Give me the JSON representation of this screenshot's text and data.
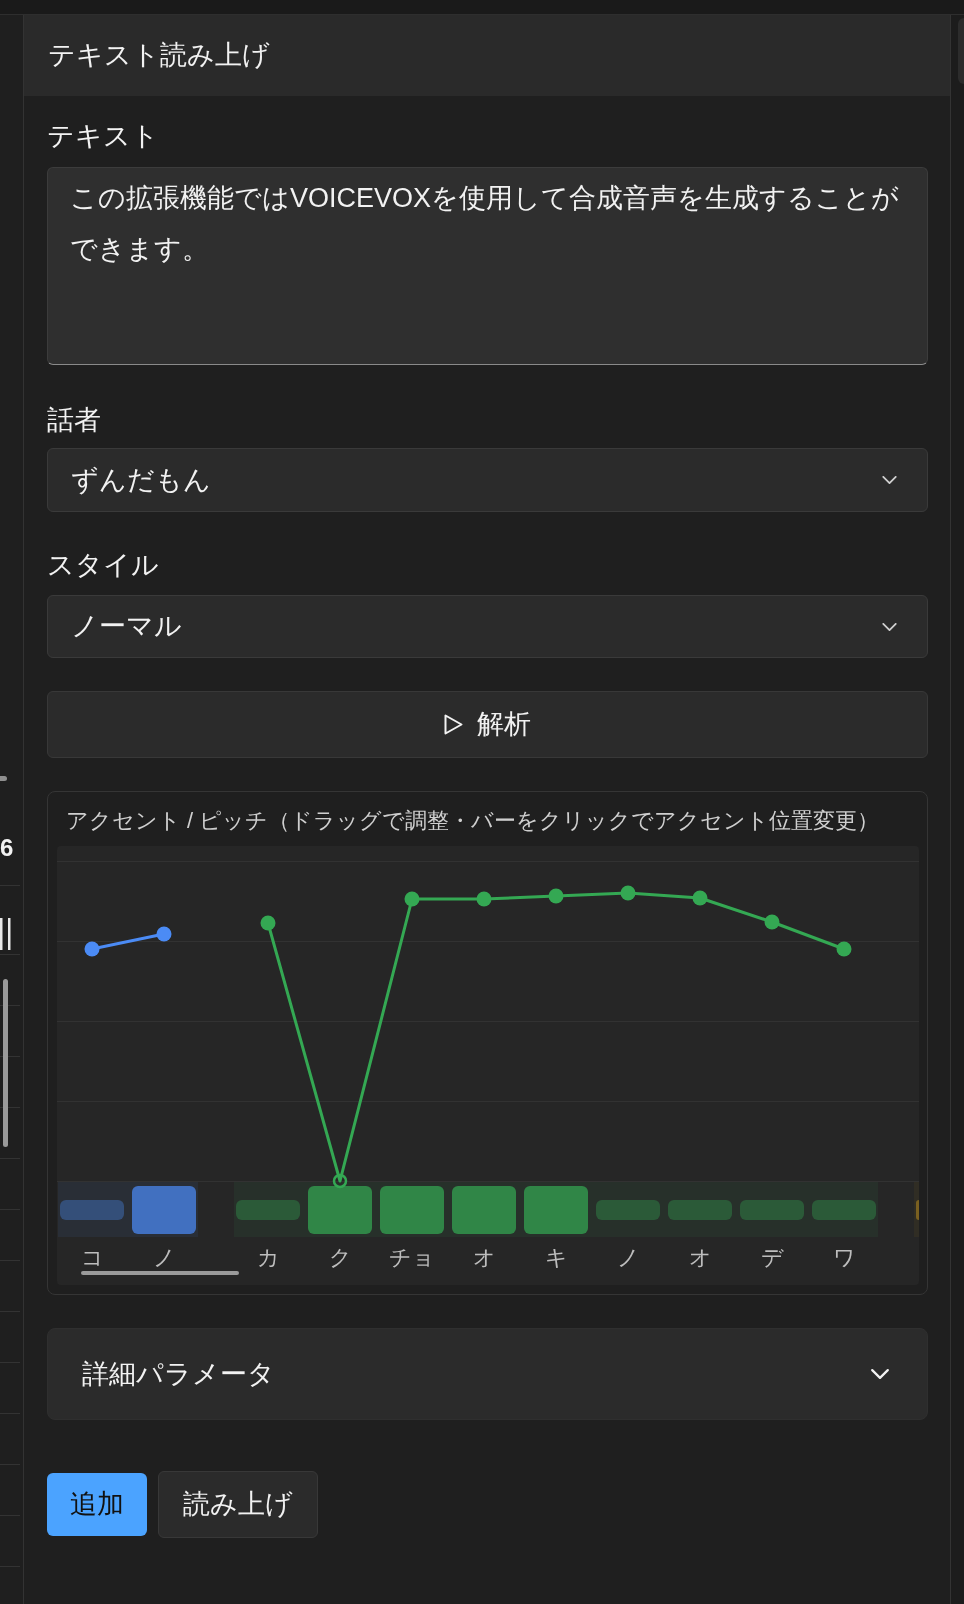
{
  "side_panel": {
    "value": "6"
  },
  "panel": {
    "title": "テキスト読み上げ"
  },
  "text": {
    "label": "テキスト",
    "value": "この拡張機能ではVOICEVOXを使用して合成音声を生成することができます。"
  },
  "speaker": {
    "label": "話者",
    "value": "ずんだもん"
  },
  "style": {
    "label": "スタイル",
    "value": "ノーマル"
  },
  "analyze_button": {
    "label": "解析"
  },
  "accent_editor": {
    "title": "アクセント / ピッチ（ドラッグで調整・バーをクリックでアクセント位置変更）",
    "phrases": [
      {
        "color": "#4b8bf5",
        "moras": [
          {
            "label": "コ",
            "high": false,
            "voiced": true
          },
          {
            "label": "ノ",
            "high": true,
            "voiced": true
          }
        ]
      },
      {
        "color": "#34a853",
        "moras": [
          {
            "label": "カ",
            "high": false,
            "voiced": true
          },
          {
            "label": "ク",
            "high": true,
            "voiced": false
          },
          {
            "label": "チョ",
            "high": true,
            "voiced": true
          },
          {
            "label": "オ",
            "high": true,
            "voiced": true
          },
          {
            "label": "キ",
            "high": true,
            "voiced": true
          },
          {
            "label": "ノ",
            "high": false,
            "voiced": true
          },
          {
            "label": "オ",
            "high": false,
            "voiced": true
          },
          {
            "label": "デ",
            "high": false,
            "voiced": true
          },
          {
            "label": "ワ",
            "high": false,
            "voiced": true
          }
        ]
      },
      {
        "color": "#7a6020"
      }
    ]
  },
  "details": {
    "label": "詳細パラメータ",
    "expanded": false
  },
  "buttons": [
    {
      "label": "追加",
      "kind": "primary"
    },
    {
      "label": "読み上げ",
      "kind": "secondary"
    }
  ]
}
